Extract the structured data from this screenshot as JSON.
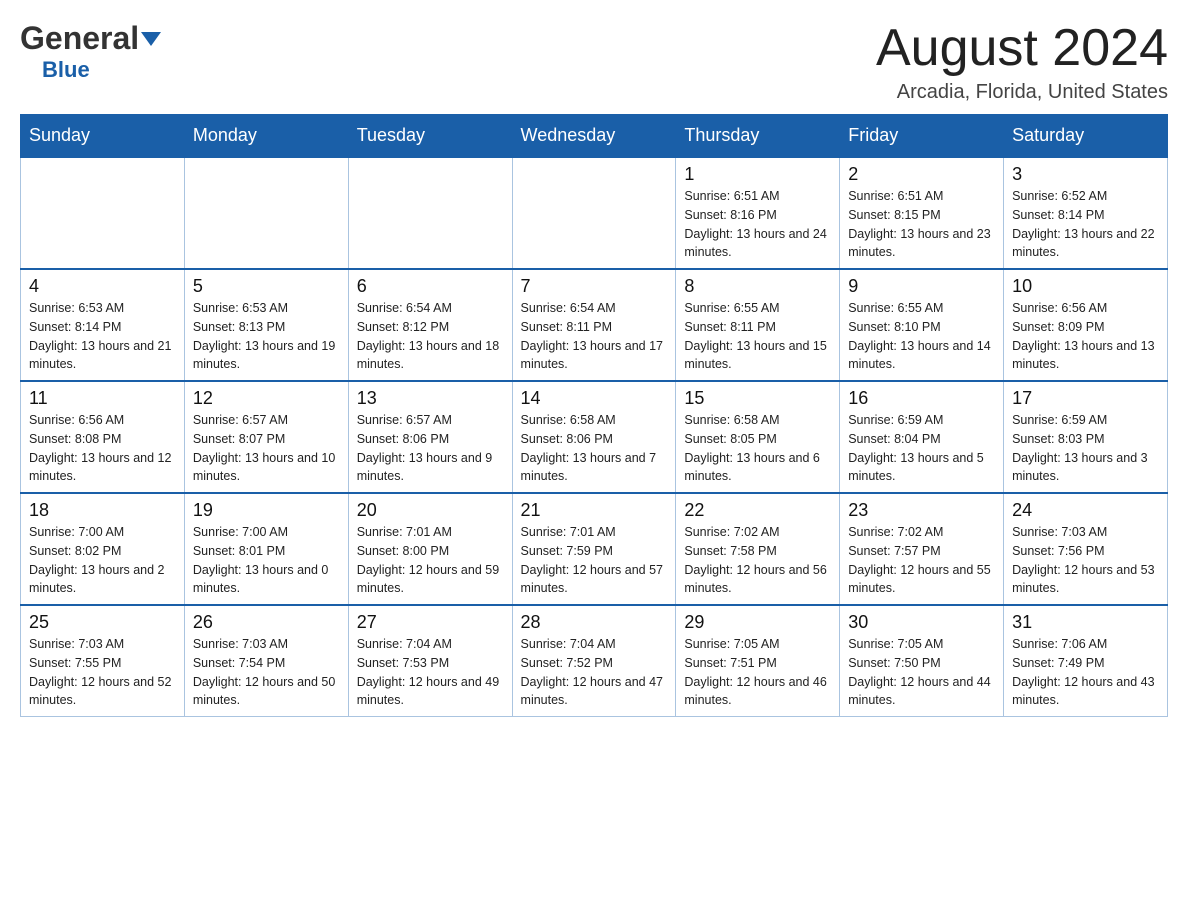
{
  "header": {
    "logo_general": "General",
    "logo_blue": "Blue",
    "month_title": "August 2024",
    "location": "Arcadia, Florida, United States"
  },
  "days_of_week": [
    "Sunday",
    "Monday",
    "Tuesday",
    "Wednesday",
    "Thursday",
    "Friday",
    "Saturday"
  ],
  "weeks": [
    [
      {
        "day": "",
        "info": ""
      },
      {
        "day": "",
        "info": ""
      },
      {
        "day": "",
        "info": ""
      },
      {
        "day": "",
        "info": ""
      },
      {
        "day": "1",
        "info": "Sunrise: 6:51 AM\nSunset: 8:16 PM\nDaylight: 13 hours and 24 minutes."
      },
      {
        "day": "2",
        "info": "Sunrise: 6:51 AM\nSunset: 8:15 PM\nDaylight: 13 hours and 23 minutes."
      },
      {
        "day": "3",
        "info": "Sunrise: 6:52 AM\nSunset: 8:14 PM\nDaylight: 13 hours and 22 minutes."
      }
    ],
    [
      {
        "day": "4",
        "info": "Sunrise: 6:53 AM\nSunset: 8:14 PM\nDaylight: 13 hours and 21 minutes."
      },
      {
        "day": "5",
        "info": "Sunrise: 6:53 AM\nSunset: 8:13 PM\nDaylight: 13 hours and 19 minutes."
      },
      {
        "day": "6",
        "info": "Sunrise: 6:54 AM\nSunset: 8:12 PM\nDaylight: 13 hours and 18 minutes."
      },
      {
        "day": "7",
        "info": "Sunrise: 6:54 AM\nSunset: 8:11 PM\nDaylight: 13 hours and 17 minutes."
      },
      {
        "day": "8",
        "info": "Sunrise: 6:55 AM\nSunset: 8:11 PM\nDaylight: 13 hours and 15 minutes."
      },
      {
        "day": "9",
        "info": "Sunrise: 6:55 AM\nSunset: 8:10 PM\nDaylight: 13 hours and 14 minutes."
      },
      {
        "day": "10",
        "info": "Sunrise: 6:56 AM\nSunset: 8:09 PM\nDaylight: 13 hours and 13 minutes."
      }
    ],
    [
      {
        "day": "11",
        "info": "Sunrise: 6:56 AM\nSunset: 8:08 PM\nDaylight: 13 hours and 12 minutes."
      },
      {
        "day": "12",
        "info": "Sunrise: 6:57 AM\nSunset: 8:07 PM\nDaylight: 13 hours and 10 minutes."
      },
      {
        "day": "13",
        "info": "Sunrise: 6:57 AM\nSunset: 8:06 PM\nDaylight: 13 hours and 9 minutes."
      },
      {
        "day": "14",
        "info": "Sunrise: 6:58 AM\nSunset: 8:06 PM\nDaylight: 13 hours and 7 minutes."
      },
      {
        "day": "15",
        "info": "Sunrise: 6:58 AM\nSunset: 8:05 PM\nDaylight: 13 hours and 6 minutes."
      },
      {
        "day": "16",
        "info": "Sunrise: 6:59 AM\nSunset: 8:04 PM\nDaylight: 13 hours and 5 minutes."
      },
      {
        "day": "17",
        "info": "Sunrise: 6:59 AM\nSunset: 8:03 PM\nDaylight: 13 hours and 3 minutes."
      }
    ],
    [
      {
        "day": "18",
        "info": "Sunrise: 7:00 AM\nSunset: 8:02 PM\nDaylight: 13 hours and 2 minutes."
      },
      {
        "day": "19",
        "info": "Sunrise: 7:00 AM\nSunset: 8:01 PM\nDaylight: 13 hours and 0 minutes."
      },
      {
        "day": "20",
        "info": "Sunrise: 7:01 AM\nSunset: 8:00 PM\nDaylight: 12 hours and 59 minutes."
      },
      {
        "day": "21",
        "info": "Sunrise: 7:01 AM\nSunset: 7:59 PM\nDaylight: 12 hours and 57 minutes."
      },
      {
        "day": "22",
        "info": "Sunrise: 7:02 AM\nSunset: 7:58 PM\nDaylight: 12 hours and 56 minutes."
      },
      {
        "day": "23",
        "info": "Sunrise: 7:02 AM\nSunset: 7:57 PM\nDaylight: 12 hours and 55 minutes."
      },
      {
        "day": "24",
        "info": "Sunrise: 7:03 AM\nSunset: 7:56 PM\nDaylight: 12 hours and 53 minutes."
      }
    ],
    [
      {
        "day": "25",
        "info": "Sunrise: 7:03 AM\nSunset: 7:55 PM\nDaylight: 12 hours and 52 minutes."
      },
      {
        "day": "26",
        "info": "Sunrise: 7:03 AM\nSunset: 7:54 PM\nDaylight: 12 hours and 50 minutes."
      },
      {
        "day": "27",
        "info": "Sunrise: 7:04 AM\nSunset: 7:53 PM\nDaylight: 12 hours and 49 minutes."
      },
      {
        "day": "28",
        "info": "Sunrise: 7:04 AM\nSunset: 7:52 PM\nDaylight: 12 hours and 47 minutes."
      },
      {
        "day": "29",
        "info": "Sunrise: 7:05 AM\nSunset: 7:51 PM\nDaylight: 12 hours and 46 minutes."
      },
      {
        "day": "30",
        "info": "Sunrise: 7:05 AM\nSunset: 7:50 PM\nDaylight: 12 hours and 44 minutes."
      },
      {
        "day": "31",
        "info": "Sunrise: 7:06 AM\nSunset: 7:49 PM\nDaylight: 12 hours and 43 minutes."
      }
    ]
  ]
}
